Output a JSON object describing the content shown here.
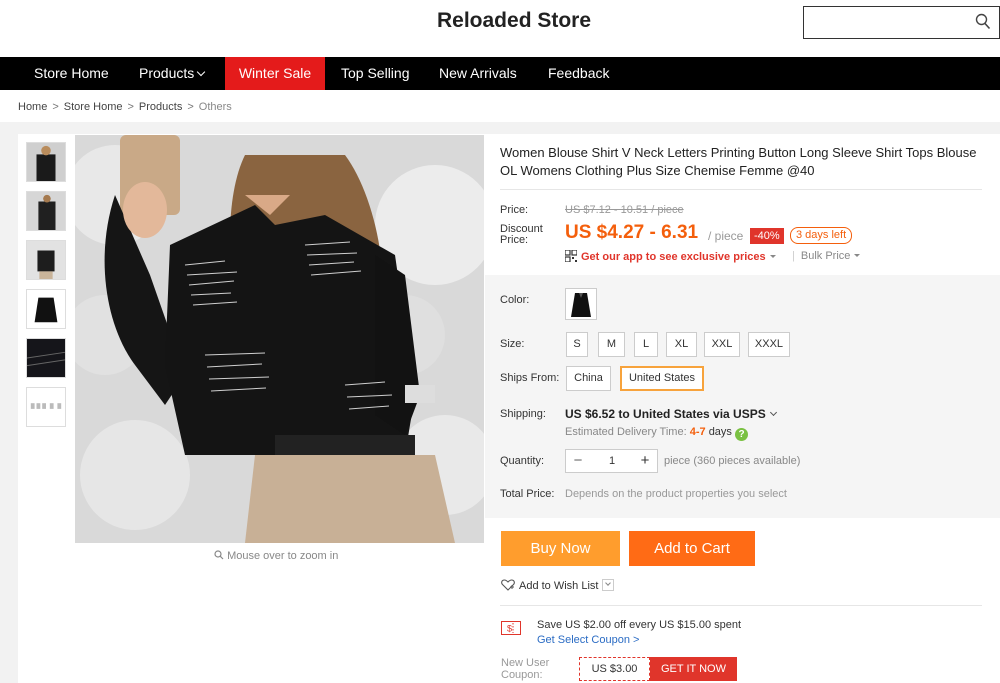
{
  "header": {
    "store_name": "Reloaded Store",
    "search_placeholder": ""
  },
  "nav": {
    "items": [
      {
        "label": "Store Home"
      },
      {
        "label": "Products"
      },
      {
        "label": "Winter Sale"
      },
      {
        "label": "Top Selling"
      },
      {
        "label": "New Arrivals"
      },
      {
        "label": "Feedback"
      }
    ],
    "active_color": "#e41b1b"
  },
  "breadcrumb": [
    "Home",
    "Store Home",
    "Products",
    "Others"
  ],
  "gallery": {
    "zoom_hint": "Mouse over to zoom in",
    "thumb_count": 6
  },
  "product": {
    "title": "Women Blouse Shirt V Neck Letters Printing Button Long Sleeve Shirt Tops Blouse OL Womens Clothing Plus Size Chemise Femme @40",
    "price_label": "Price:",
    "original_price": "US $7.12 - 10.51 / piece",
    "discount_label": "Discount Price:",
    "discount_price": "US $4.27 - 6.31",
    "per_piece": "/ piece",
    "discount_badge": "-40%",
    "days_left": "3 days left",
    "app_promo": "Get our app to see exclusive prices",
    "bulk_price": "Bulk Price",
    "accent_color": "#f45f0c"
  },
  "properties": {
    "color_label": "Color:",
    "size_label": "Size:",
    "sizes": [
      "S",
      "M",
      "L",
      "XL",
      "XXL",
      "XXXL"
    ],
    "ships_from_label": "Ships From:",
    "ships_from": [
      "China",
      "United States"
    ],
    "ships_from_selected": "United States",
    "shipping_label": "Shipping:",
    "shipping_cost": "US $6.52 to United States via USPS",
    "delivery_label": "Estimated Delivery Time:",
    "delivery_days": "4-7",
    "delivery_unit": "days",
    "quantity_label": "Quantity:",
    "quantity": "1",
    "quantity_available": "piece (360 pieces available)",
    "total_label": "Total Price:",
    "total_hint": "Depends on the product properties you select"
  },
  "actions": {
    "buy_now": "Buy Now",
    "add_to_cart": "Add to Cart",
    "wish_list": "Add to Wish List"
  },
  "coupons": {
    "store_coupon_text": "Save US $2.00 off every US $15.00 spent",
    "store_coupon_link": "Get Select Coupon >",
    "new_user_label": "New User Coupon:",
    "new_user_amount": "US $3.00",
    "new_user_button": "GET IT NOW"
  }
}
